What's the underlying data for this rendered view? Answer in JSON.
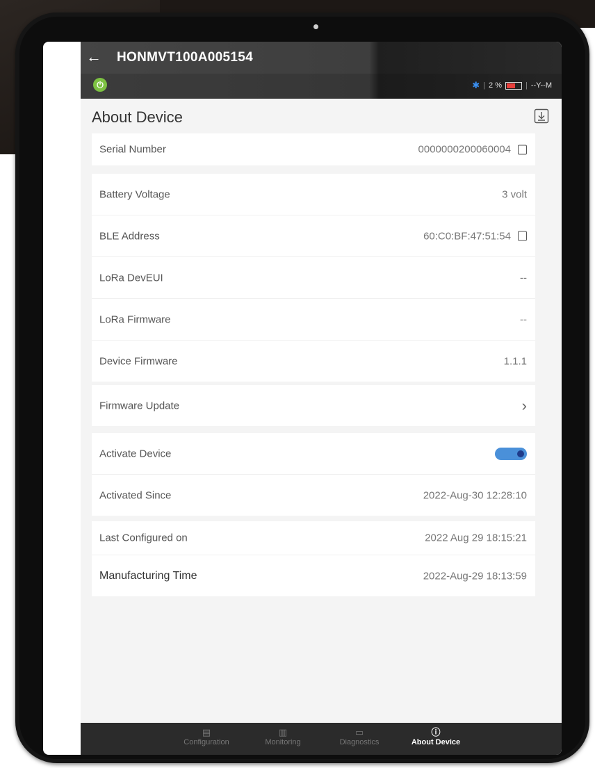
{
  "topbar": {
    "back_icon": "arrow-left-icon",
    "device_name": "HONMVT100A005154",
    "status": {
      "bluetooth_icon": "bluetooth-icon",
      "battery_percent": "2 %",
      "battery_level": 0.5,
      "signal_text": "--Y--M"
    }
  },
  "header": {
    "title": "About Device",
    "download_icon": "download-icon"
  },
  "cards": {
    "serial": {
      "label": "Serial Number",
      "value": "0000000200060004"
    },
    "hardware": [
      {
        "label": "Battery Voltage",
        "value": "3 volt"
      },
      {
        "label": "BLE Address",
        "value": "60:C0:BF:47:51:54"
      },
      {
        "label": "LoRa DevEUI",
        "value": "--"
      },
      {
        "label": "LoRa Firmware",
        "value": "--"
      },
      {
        "label": "Device Firmware",
        "value": "1.1.1"
      }
    ],
    "firmware_update": {
      "label": "Firmware Update"
    },
    "activation": {
      "activate_label": "Activate Device",
      "activate_on": true,
      "since_label": "Activated Since",
      "since_value": "2022-Aug-30 12:28:10"
    },
    "config": {
      "last_configured_label": "Last Configured on",
      "last_configured_value": "2022 Aug 29 18:15:21",
      "manufacturing_label": "Manufacturing Time",
      "manufacturing_value": "2022-Aug-29 18:13:59"
    }
  },
  "bottom_nav": [
    {
      "label": "Configuration",
      "icon": "document-icon",
      "active": false
    },
    {
      "label": "Monitoring",
      "icon": "chart-icon",
      "active": false
    },
    {
      "label": "Diagnostics",
      "icon": "monitor-icon",
      "active": false
    },
    {
      "label": "About Device",
      "icon": "info-icon",
      "active": true
    }
  ],
  "colors": {
    "accent": "#4a90d9",
    "topbar": "#454545",
    "power": "#7dc242",
    "battery_low": "#e8403c"
  }
}
